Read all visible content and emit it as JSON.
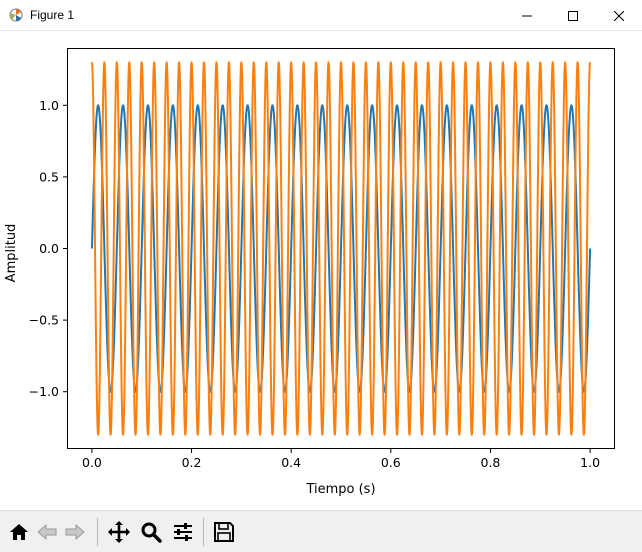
{
  "window": {
    "title": "Figure 1"
  },
  "toolbar": {
    "buttons": [
      "home-icon",
      "back-icon",
      "forward-icon",
      "pan-icon",
      "zoom-icon",
      "configure-subplots-icon",
      "save-icon"
    ]
  },
  "chart_data": {
    "type": "line",
    "title": "",
    "xlabel": "Tiempo (s)",
    "ylabel": "Amplitud",
    "xlim": [
      -0.05,
      1.05
    ],
    "ylim": [
      -1.4,
      1.4
    ],
    "xticks": [
      "0.0",
      "0.2",
      "0.4",
      "0.6",
      "0.8",
      "1.0"
    ],
    "yticks": [
      "−1.0",
      "−0.5",
      "0.0",
      "0.5",
      "1.0"
    ],
    "grid": false,
    "series": [
      {
        "color": "#1f77b4",
        "function": "sine",
        "amplitude": 1.0,
        "frequency_hz": 20,
        "x_range": [
          0,
          1
        ]
      },
      {
        "color": "#ff7f0e",
        "function": "cosine",
        "amplitude": 1.3,
        "frequency_hz": 40,
        "x_range": [
          0,
          1
        ]
      }
    ]
  }
}
